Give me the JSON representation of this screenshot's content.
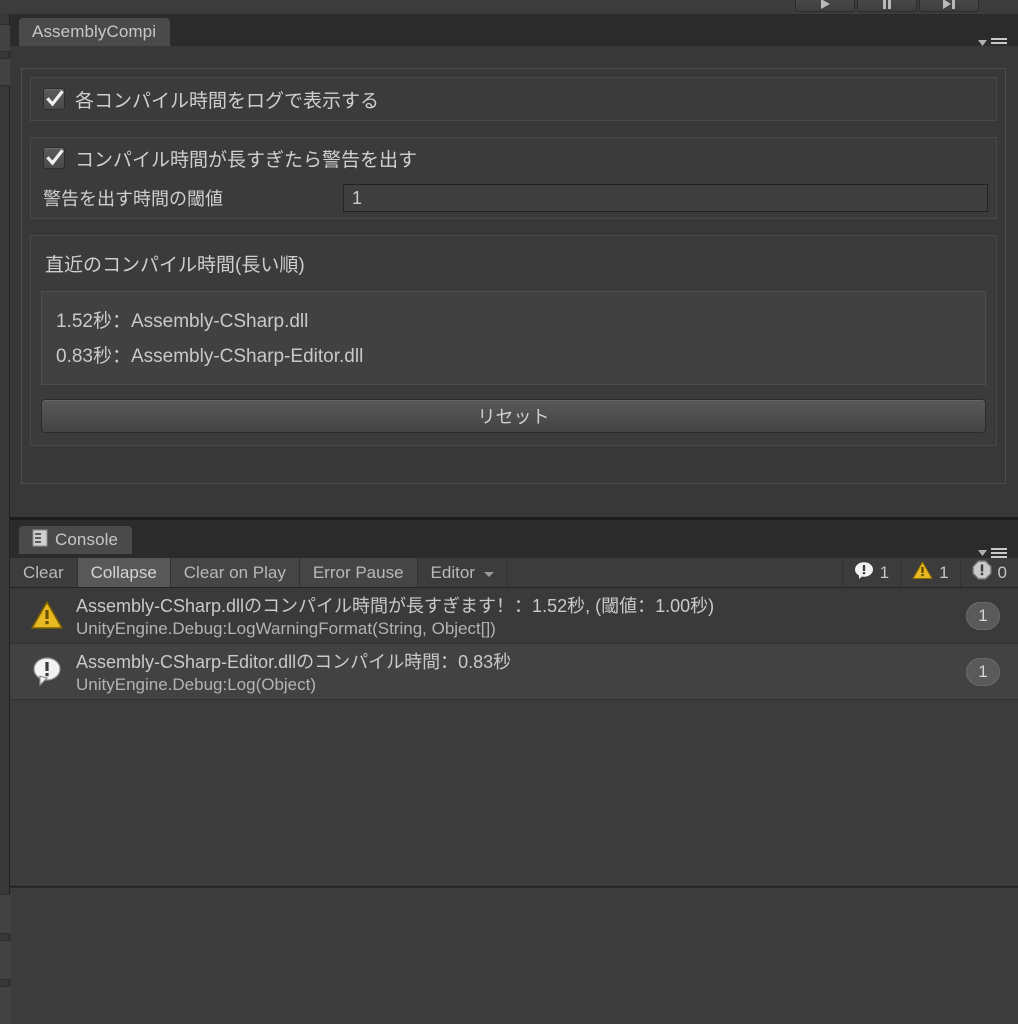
{
  "toolbar": {
    "play_buttons": [
      "play-button",
      "pause-button",
      "step-button"
    ]
  },
  "assembly_window": {
    "tab_label": "AssemblyCompi",
    "menu_icon": "panel-menu-icon",
    "log_each_compile": {
      "checked": true,
      "label": "各コンパイル時間をログで表示する"
    },
    "warn_too_long": {
      "checked": true,
      "label": "コンパイル時間が長すぎたら警告を出す",
      "threshold_label": "警告を出す時間の閾値",
      "threshold_value": "1",
      "threshold_placeholder": "1"
    },
    "recent": {
      "title": "直近のコンパイル時間(長い順)",
      "items": [
        "1.52秒：Assembly-CSharp.dll",
        "0.83秒：Assembly-CSharp-Editor.dll"
      ]
    },
    "reset_label": "リセット"
  },
  "console_window": {
    "tab_label": "Console",
    "tab_icon": "console-icon",
    "menu_icon": "panel-menu-icon",
    "toolbar": {
      "clear": "Clear",
      "collapse": "Collapse",
      "clear_on_play": "Clear on Play",
      "error_pause": "Error Pause",
      "filter": "Editor",
      "caret_icon": "chevron-down-icon"
    },
    "counts": {
      "info_icon": "info-icon",
      "info": "1",
      "warning_icon": "warning-icon",
      "warning": "1",
      "error_icon": "error-icon",
      "error": "0"
    },
    "entries": [
      {
        "icon": "warning-icon",
        "message": "Assembly-CSharp.dllのコンパイル時間が長すぎます！：1.52秒, (閾値：1.00秒)",
        "stack": "UnityEngine.Debug:LogWarningFormat(String, Object[])",
        "count": "1"
      },
      {
        "icon": "info-icon",
        "message": "Assembly-CSharp-Editor.dllのコンパイル時間：0.83秒",
        "stack": "UnityEngine.Debug:Log(Object)",
        "count": "1"
      }
    ]
  },
  "colors": {
    "window_bg": "#383838",
    "toolbar_bg": "#3c3c3c",
    "tab_active": "#4a4a4a",
    "text": "#cfcfcf",
    "warning": "#e8b923",
    "info": "#f2f2f2"
  }
}
